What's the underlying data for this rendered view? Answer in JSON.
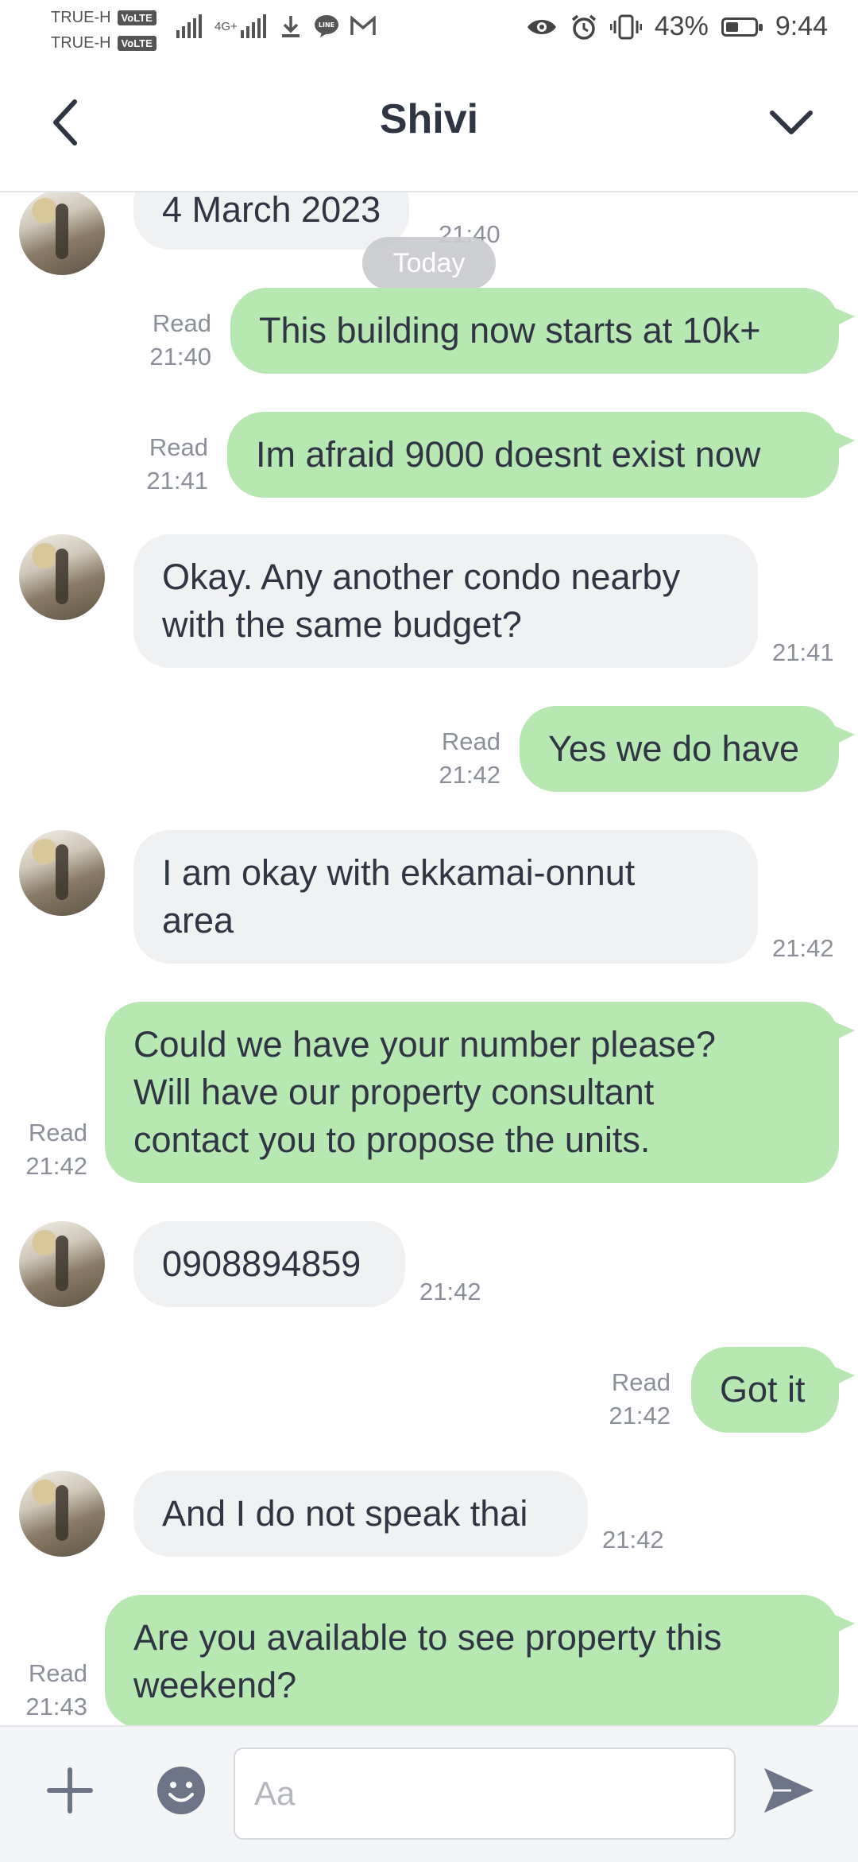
{
  "status_bar": {
    "carrier_1": "TRUE-H",
    "carrier_2": "TRUE-H",
    "volte": "VoLTE",
    "network": "4G+",
    "battery_percent": "43%",
    "battery_level": 0.43,
    "time": "9:44",
    "icons": [
      "signal-icon",
      "download-icon",
      "line-app-icon",
      "gmail-icon",
      "eye-icon",
      "alarm-icon",
      "vibrate-icon",
      "battery-icon"
    ]
  },
  "header": {
    "title": "Shivi",
    "back_icon": "chevron-left-icon",
    "menu_icon": "chevron-down-icon"
  },
  "chat": {
    "date_chip": "Today",
    "messages": [
      {
        "side": "in",
        "text": "4 March 2023",
        "time": "21:40"
      },
      {
        "side": "out",
        "status": "Read",
        "time": "21:40",
        "text": "This building now starts at 10k+"
      },
      {
        "side": "out",
        "status": "Read",
        "time": "21:41",
        "text": "Im afraid 9000 doesnt exist now"
      },
      {
        "side": "in",
        "lines": [
          "Okay. Any another condo nearby",
          "with the same budget?"
        ],
        "time": "21:41"
      },
      {
        "side": "out",
        "status": "Read",
        "time": "21:42",
        "text": "Yes we do have"
      },
      {
        "side": "in",
        "lines": [
          "I am okay with ekkamai-onnut",
          "area"
        ],
        "time": "21:42"
      },
      {
        "side": "out",
        "status": "Read",
        "time": "21:42",
        "lines": [
          "Could we have your number please?",
          "Will have our property consultant",
          "contact you to propose the units."
        ]
      },
      {
        "side": "in",
        "text": "0908894859",
        "time": "21:42"
      },
      {
        "side": "out",
        "status": "Read",
        "time": "21:42",
        "text": "Got it"
      },
      {
        "side": "in",
        "text": "And I do not speak thai",
        "time": "21:42"
      },
      {
        "side": "out",
        "status": "Read",
        "time": "21:43",
        "lines": [
          "Are you available to see property this",
          "weekend?"
        ]
      }
    ]
  },
  "input_bar": {
    "placeholder": "Aa",
    "plus_icon": "plus-icon",
    "emoji_icon": "emoji-icon",
    "send_icon": "send-icon"
  },
  "colors": {
    "outgoing_bubble": "#b7e8b1",
    "incoming_bubble": "#f0f1f3",
    "text": "#2f3542",
    "meta_text": "#8a8f99"
  }
}
